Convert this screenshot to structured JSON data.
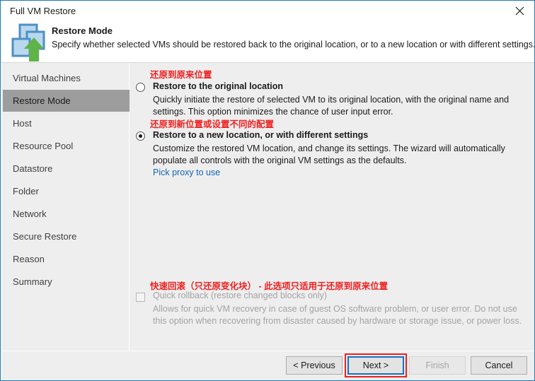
{
  "window": {
    "title": "Full VM Restore",
    "close_icon": "close-icon",
    "border_color": "#1a7ab8"
  },
  "header": {
    "icon": "vm-restore-icon",
    "title": "Restore Mode",
    "subtitle": "Specify whether selected VMs should be restored back to the original location, or to a new location or with different settings."
  },
  "sidebar": {
    "items": [
      {
        "label": "Virtual Machines",
        "selected": false
      },
      {
        "label": "Restore Mode",
        "selected": true
      },
      {
        "label": "Host",
        "selected": false
      },
      {
        "label": "Resource Pool",
        "selected": false
      },
      {
        "label": "Datastore",
        "selected": false
      },
      {
        "label": "Folder",
        "selected": false
      },
      {
        "label": "Network",
        "selected": false
      },
      {
        "label": "Secure Restore",
        "selected": false
      },
      {
        "label": "Reason",
        "selected": false
      },
      {
        "label": "Summary",
        "selected": false
      }
    ],
    "selected_bg": "#9d9d9d"
  },
  "main": {
    "annotation_color": "#ee2020",
    "option_original": {
      "annotation": "还原到原来位置",
      "label": "Restore to the original location",
      "description": "Quickly initiate the restore of selected VM to its original location, with the original name and settings. This option minimizes the chance of user input error.",
      "selected": false
    },
    "option_new": {
      "annotation": "还原到新位置或设置不同的配置",
      "label": "Restore to a new location, or with different settings",
      "description": "Customize the restored VM location, and change its settings. The wizard will automatically populate all controls with the original VM settings as the defaults.",
      "selected": true
    },
    "proxy_link": "Pick proxy to use",
    "quick_rollback": {
      "annotation": "快速回滚（只还原变化块） - 此选项只适用于还原到原来位置",
      "label": "Quick rollback (restore changed blocks only)",
      "description": "Allows for quick VM recovery in case of guest OS software problem, or user error. Do not use this option when recovering from disaster caused by hardware or storage issue, or power loss.",
      "checked": false,
      "enabled": false
    }
  },
  "footer": {
    "previous": "< Previous",
    "next": "Next >",
    "finish": "Finish",
    "cancel": "Cancel",
    "next_focus_color": "#1272c4",
    "next_highlight_color": "#ee2020",
    "finish_enabled": false
  }
}
